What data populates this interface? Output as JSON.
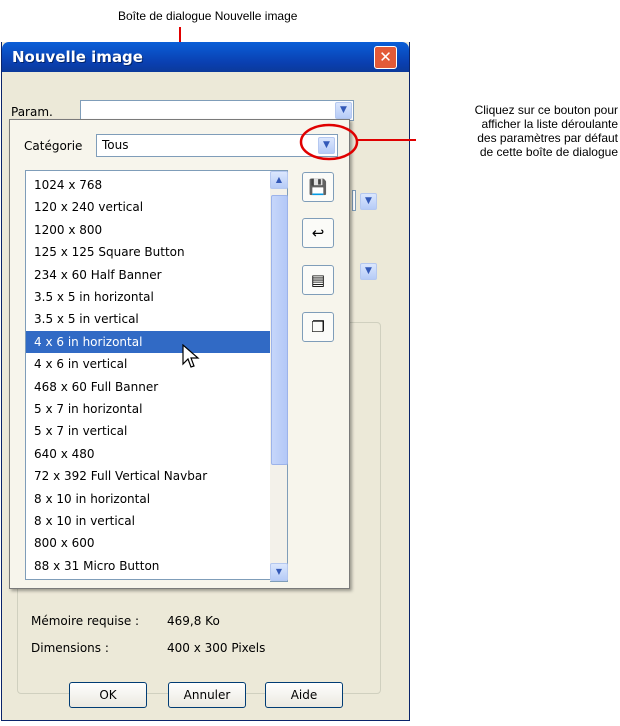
{
  "annotations": {
    "top": "Boîte de dialogue Nouvelle image",
    "right": [
      "Cliquez sur ce bouton pour",
      "afficher la liste déroulante",
      "des paramètres par défaut",
      "de cette boîte de dialogue"
    ]
  },
  "dialog": {
    "title": "Nouvelle image",
    "param_label": "Param.",
    "param_value": "",
    "categorie_label": "Catégorie",
    "categorie_value": "Tous",
    "memoire_label": "Mémoire requise :",
    "memoire_value": "469,8 Ko",
    "dimensions_label": "Dimensions :",
    "dimensions_value": "400 x 300 Pixels",
    "buttons": {
      "ok": "OK",
      "annuler": "Annuler",
      "aide": "Aide"
    }
  },
  "presets": [
    "1024 x 768",
    "120 x 240 vertical",
    "1200 x 800",
    "125 x 125 Square Button",
    "234 x 60 Half Banner",
    "3.5 x 5 in horizontal",
    "3.5 x 5 in vertical",
    "4 x 6 in horizontal",
    "4 x 6 in vertical",
    "468 x 60 Full Banner",
    "5 x 7 in horizontal",
    "5 x 7 in vertical",
    "640 x 480",
    "72 x 392 Full Vertical Navbar",
    "8 x 10 in horizontal",
    "8 x 10 in vertical",
    "800 x 600",
    "88 x 31 Micro Button"
  ],
  "selected_preset": "4 x 6 in horizontal",
  "icons": [
    "save-icon",
    "undo-icon",
    "edit-presets-icon",
    "copy-icon",
    "close-icon",
    "chevron-down-icon",
    "cursor-icon"
  ],
  "colors": {
    "selection": "#316ac5",
    "titlebar": "#0a5fd8",
    "callout": "#e00000"
  }
}
